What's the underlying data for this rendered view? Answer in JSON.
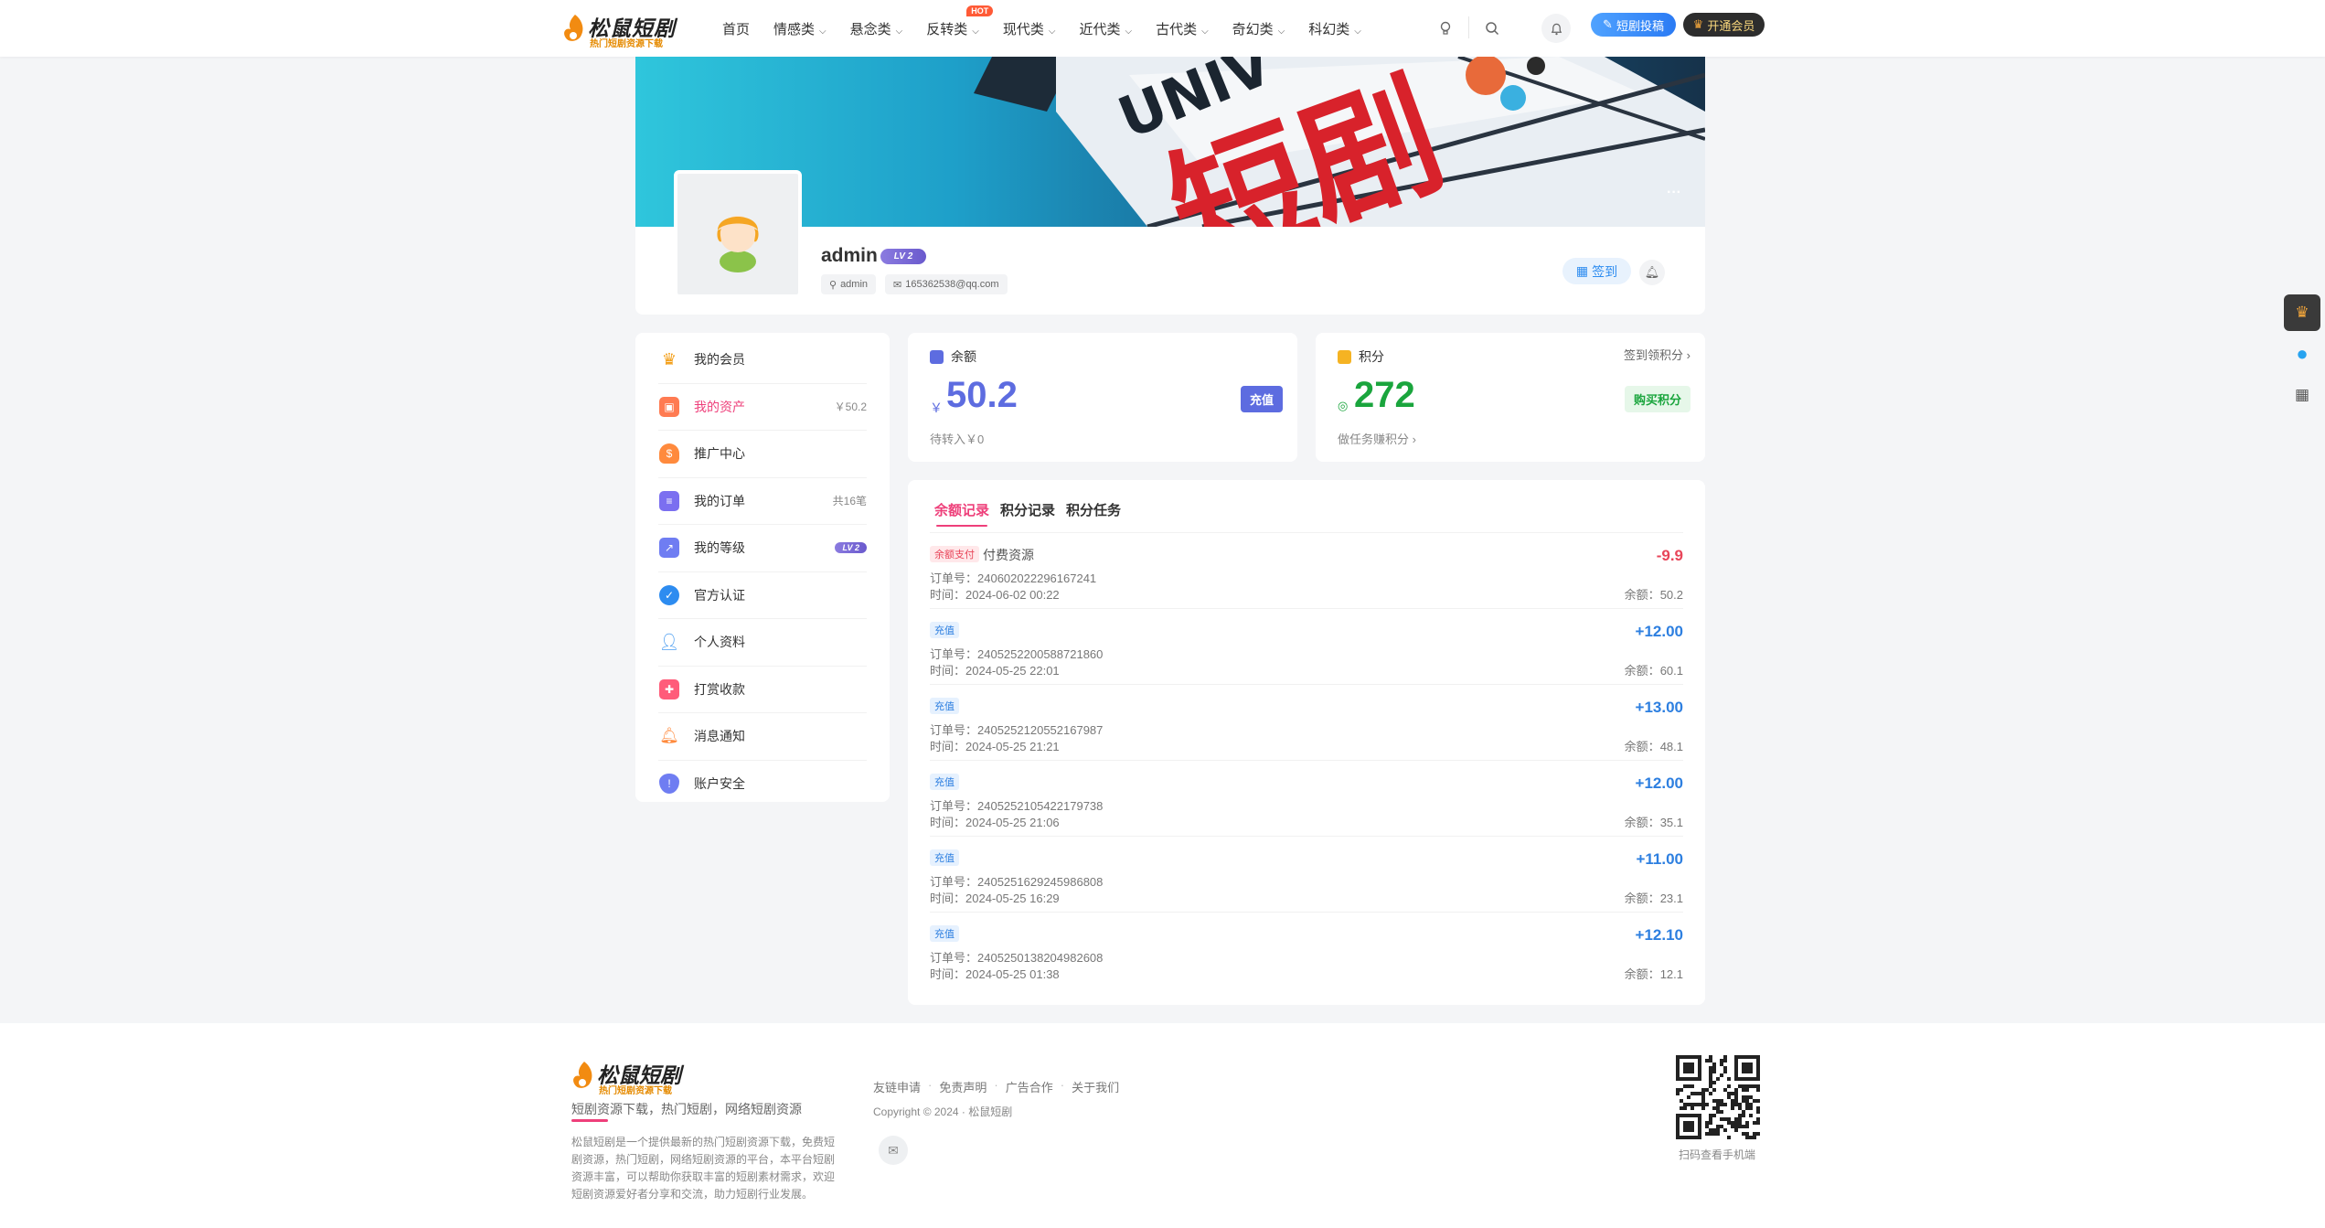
{
  "header": {
    "logo_title": "松鼠短剧",
    "logo_subtitle": "热门短剧资源下载",
    "nav": [
      {
        "label": "首页",
        "has_dropdown": false
      },
      {
        "label": "情感类",
        "has_dropdown": true
      },
      {
        "label": "悬念类",
        "has_dropdown": true
      },
      {
        "label": "反转类",
        "has_dropdown": true,
        "badge": "HOT"
      },
      {
        "label": "现代类",
        "has_dropdown": true
      },
      {
        "label": "近代类",
        "has_dropdown": true
      },
      {
        "label": "古代类",
        "has_dropdown": true
      },
      {
        "label": "奇幻类",
        "has_dropdown": true
      },
      {
        "label": "科幻类",
        "has_dropdown": true
      }
    ],
    "icons": [
      "lightbulb-icon",
      "search-icon",
      "bell-icon"
    ],
    "post_button": "短剧投稿",
    "vip_button": "开通会员"
  },
  "profile": {
    "username": "admin",
    "level": "LV 2",
    "login_tag": "admin",
    "email_tag": "165362538@qq.com",
    "sign_button": "签到",
    "more_icon": "ellipsis-icon",
    "banner_text_latin": "UNIV",
    "banner_text_cn": "短剧"
  },
  "menu": [
    {
      "label": "我的会员",
      "right": "",
      "color": "#f39c12",
      "icon": "crown-icon"
    },
    {
      "label": "我的资产",
      "right": "￥50.2",
      "color": "#ff7b52",
      "icon": "wallet-icon",
      "active": true
    },
    {
      "label": "推广中心",
      "right": "",
      "color": "#ff8a3d",
      "icon": "money-bag-icon"
    },
    {
      "label": "我的订单",
      "right": "共16笔",
      "color": "#7b6ff0",
      "icon": "order-icon"
    },
    {
      "label": "我的等级",
      "right": "LV 2",
      "color": "#6f7df2",
      "icon": "level-chart-icon"
    },
    {
      "label": "官方认证",
      "right": "",
      "color": "#2d8cf0",
      "icon": "verified-icon"
    },
    {
      "label": "个人资料",
      "right": "",
      "color": "#4a9cf0",
      "icon": "user-profile-icon"
    },
    {
      "label": "打赏收款",
      "right": "",
      "color": "#ff5c7a",
      "icon": "gift-icon"
    },
    {
      "label": "消息通知",
      "right": "",
      "color": "#ff8a3d",
      "icon": "bell-icon"
    },
    {
      "label": "账户安全",
      "right": "",
      "color": "#6f7df2",
      "icon": "shield-icon"
    }
  ],
  "balance": {
    "title": "余额",
    "currency": "￥",
    "amount": "50.2",
    "sub": "待转入￥0",
    "button": "充值"
  },
  "points": {
    "title": "积分",
    "amount": "272",
    "sub": "做任务赚积分",
    "button": "购买积分",
    "top_link": "签到领积分"
  },
  "records": {
    "tabs": [
      "余额记录",
      "积分记录",
      "积分任务"
    ],
    "order_prefix": "订单号：",
    "time_prefix": "时间：",
    "balance_prefix": "余额：",
    "items": [
      {
        "tag": "余额支付",
        "type": "pay",
        "desc": "付费资源",
        "order": "240602022296167241",
        "time": "2024-06-02 00:22",
        "amount": "-9.9",
        "balance": "50.2"
      },
      {
        "tag": "充值",
        "type": "rc",
        "desc": "",
        "order": "240525220058872186​0",
        "time": "2024-05-25 22:01",
        "amount": "+12.00",
        "balance": "60.1"
      },
      {
        "tag": "充值",
        "type": "rc",
        "desc": "",
        "order": "2405252120552167987",
        "time": "2024-05-25 21:21",
        "amount": "+13.00",
        "balance": "48.1"
      },
      {
        "tag": "充值",
        "type": "rc",
        "desc": "",
        "order": "2405252105422179738",
        "time": "2024-05-25 21:06",
        "amount": "+12.00",
        "balance": "35.1"
      },
      {
        "tag": "充值",
        "type": "rc",
        "desc": "",
        "order": "2405251629245986808",
        "time": "2024-05-25 16:29",
        "amount": "+11.00",
        "balance": "23.1"
      },
      {
        "tag": "充值",
        "type": "rc",
        "desc": "",
        "order": "2405250138204982608",
        "time": "2024-05-25 01:38",
        "amount": "+12.10",
        "balance": "12.1"
      }
    ]
  },
  "footer": {
    "logo_title": "松鼠短剧",
    "logo_subtitle": "热门短剧资源下载",
    "slogan": "短剧资源下载，热门短剧，网络短剧资源",
    "description": "松鼠短剧是一个提供最新的热门短剧资源下载，免费短剧资源，热门短剧，网络短剧资源的平台，本平台短剧资源丰富，可以帮助你获取丰富的短剧素材需求，欢迎短剧资源爱好者分享和交流，助力短剧行业发展。",
    "links": [
      "友链申请",
      "免责声明",
      "广告合作",
      "关于我们"
    ],
    "copyright": "Copyright © 2024 · 松鼠短剧",
    "qr_caption": "扫码查看手机端"
  },
  "colors": {
    "accent_pink": "#ee3f7a",
    "balance_blue": "#5d6ce0",
    "points_green": "#1aa53d",
    "negative_red": "#e84559",
    "positive_blue": "#2d7fe0"
  }
}
